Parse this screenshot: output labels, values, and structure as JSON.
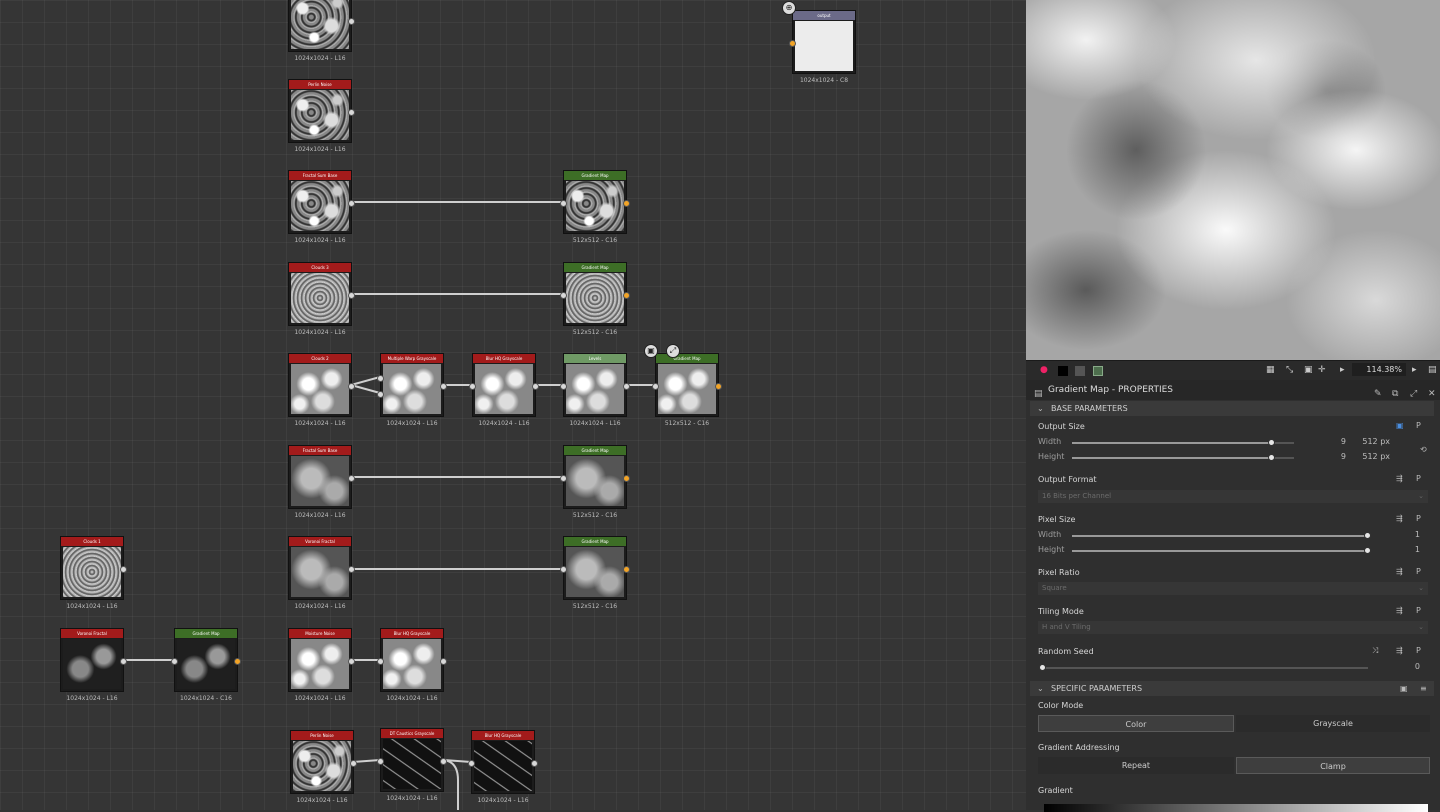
{
  "graph": {
    "nodes": [
      {
        "title": "",
        "caption": "1024x1024 - L16"
      },
      {
        "title": "Perlin Noise",
        "caption": "1024x1024 - L16"
      },
      {
        "title": "Fractal Sum Base",
        "caption": "1024x1024 - L16"
      },
      {
        "title": "Gradient Map",
        "caption": "512x512 - C16"
      },
      {
        "title": "Clouds 3",
        "caption": "1024x1024 - L16"
      },
      {
        "title": "Gradient Map",
        "caption": "512x512 - C16"
      },
      {
        "title": "Clouds 2",
        "caption": "1024x1024 - L16"
      },
      {
        "title": "Multiple Warp Grayscale",
        "caption": "1024x1024 - L16"
      },
      {
        "title": "Blur HQ Grayscale",
        "caption": "1024x1024 - L16"
      },
      {
        "title": "Levels",
        "caption": "1024x1024 - L16"
      },
      {
        "title": "Gradient Map",
        "caption": "512x512 - C16"
      },
      {
        "title": "Fractal Sum Base",
        "caption": "1024x1024 - L16"
      },
      {
        "title": "Gradient Map",
        "caption": "512x512 - C16"
      },
      {
        "title": "Clouds 1",
        "caption": "1024x1024 - L16"
      },
      {
        "title": "Voronoi Fractal",
        "caption": "1024x1024 - L16"
      },
      {
        "title": "Gradient Map",
        "caption": "512x512 - C16"
      },
      {
        "title": "Voronoi Fractal",
        "caption": "1024x1024 - L16"
      },
      {
        "title": "Gradient Map",
        "caption": "1024x1024 - C16"
      },
      {
        "title": "Moisture Noise",
        "caption": "1024x1024 - L16"
      },
      {
        "title": "Blur HQ Grayscale",
        "caption": "1024x1024 - L16"
      },
      {
        "title": "Perlin Noise",
        "caption": "1024x1024 - L16"
      },
      {
        "title": "DT Caustics Grayscale",
        "caption": "1024x1024 - L16"
      },
      {
        "title": "Blur HQ Grayscale",
        "caption": "1024x1024 - L16"
      },
      {
        "title": "output",
        "caption": "1024x1024 - C8"
      }
    ]
  },
  "preview": {
    "zoom": "114.38%"
  },
  "properties": {
    "title": "Gradient Map - PROPERTIES",
    "base_section": "BASE PARAMETERS",
    "output_size": {
      "label": "Output Size",
      "width_label": "Width",
      "height_label": "Height",
      "width_exp": "9",
      "width_px": "512 px",
      "height_exp": "9",
      "height_px": "512 px",
      "fraction": 0.9
    },
    "output_format": {
      "label": "Output Format",
      "value": "16 Bits per Channel"
    },
    "pixel_size": {
      "label": "Pixel Size",
      "width_label": "Width",
      "height_label": "Height",
      "width_value": "1",
      "height_value": "1",
      "fraction": 1.0
    },
    "pixel_ratio": {
      "label": "Pixel Ratio",
      "value": "Square"
    },
    "tiling_mode": {
      "label": "Tiling Mode",
      "value": "H and V Tiling"
    },
    "random_seed": {
      "label": "Random Seed",
      "value": "0",
      "fraction": 0.0
    },
    "specific_section": "SPECIFIC PARAMETERS",
    "color_mode": {
      "label": "Color Mode",
      "options": [
        "Color",
        "Grayscale"
      ],
      "selected": "Color"
    },
    "gradient_addressing": {
      "label": "Gradient Addressing",
      "options": [
        "Repeat",
        "Clamp"
      ],
      "selected": "Clamp"
    },
    "gradient": {
      "label": "Gradient"
    }
  },
  "colors": {
    "node_red": "#a31b1b",
    "node_green": "#3d6e26",
    "port_color": "#f2a427",
    "graph_bg": "#353535"
  }
}
